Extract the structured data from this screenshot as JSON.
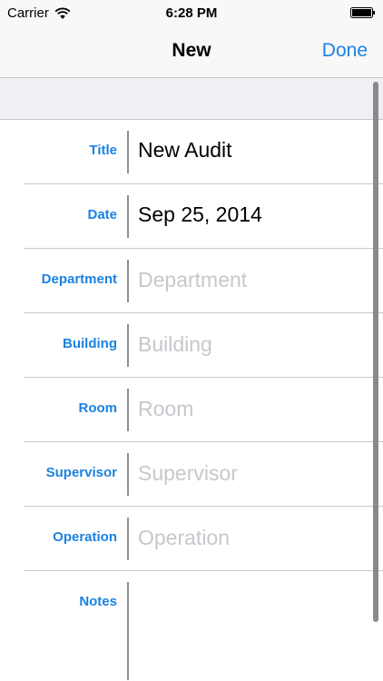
{
  "status_bar": {
    "carrier": "Carrier",
    "time": "6:28 PM",
    "wifi_icon": "wifi-icon",
    "battery_icon": "battery-icon"
  },
  "nav": {
    "title": "New",
    "done_label": "Done"
  },
  "colors": {
    "accent": "#1a82e2",
    "placeholder": "#c7c7cd",
    "separator": "#c8c7cc",
    "grouped_background": "#efeff4"
  },
  "form": {
    "title": {
      "label": "Title",
      "value": "New Audit"
    },
    "date": {
      "label": "Date",
      "value": "Sep 25, 2014"
    },
    "department": {
      "label": "Department",
      "placeholder": "Department",
      "value": ""
    },
    "building": {
      "label": "Building",
      "placeholder": "Building",
      "value": ""
    },
    "room": {
      "label": "Room",
      "placeholder": "Room",
      "value": ""
    },
    "supervisor": {
      "label": "Supervisor",
      "placeholder": "Supervisor",
      "value": ""
    },
    "operation": {
      "label": "Operation",
      "placeholder": "Operation",
      "value": ""
    },
    "notes": {
      "label": "Notes",
      "value": ""
    }
  }
}
